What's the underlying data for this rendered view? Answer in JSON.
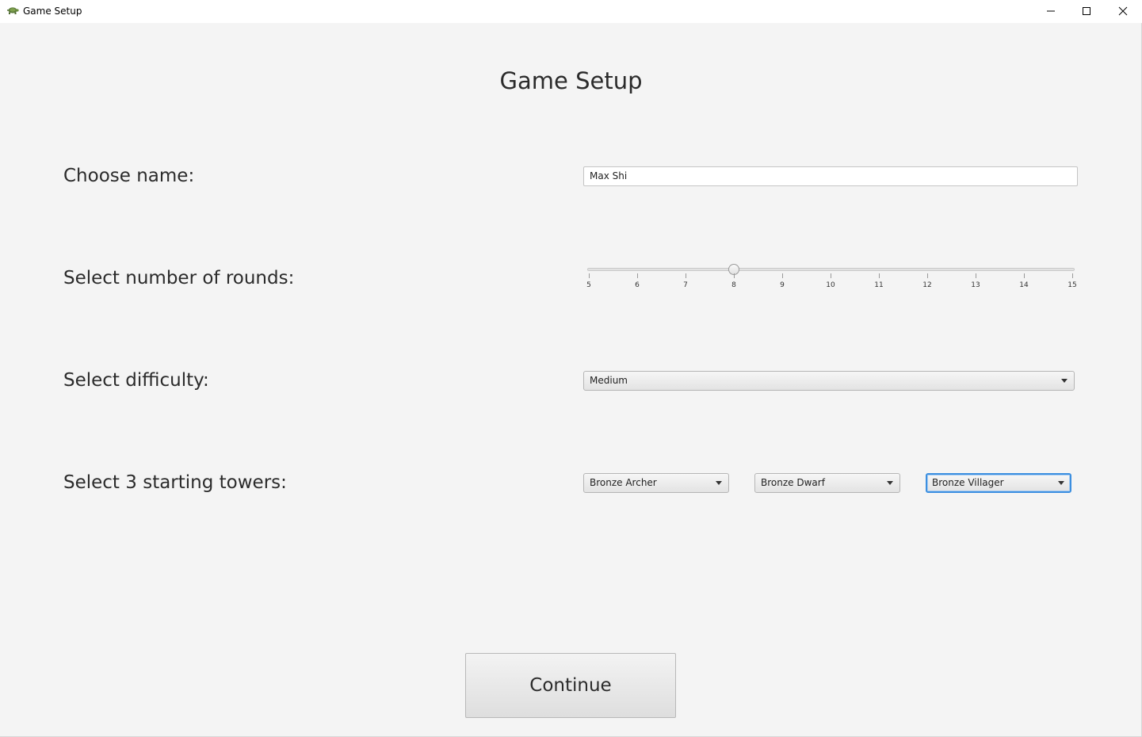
{
  "window": {
    "title": "Game Setup",
    "app_icon": "turtle-icon",
    "controls": [
      "minimize-icon",
      "maximize-icon",
      "close-icon"
    ]
  },
  "page": {
    "heading": "Game Setup"
  },
  "name_row": {
    "label": "Choose name:",
    "value": "Max Shi"
  },
  "rounds_row": {
    "label": "Select number of rounds:",
    "min": 5,
    "max": 15,
    "value": 8,
    "tick_labels": [
      "5",
      "6",
      "7",
      "8",
      "9",
      "10",
      "11",
      "12",
      "13",
      "14",
      "15"
    ]
  },
  "difficulty_row": {
    "label": "Select difficulty:",
    "selected": "Medium"
  },
  "towers_row": {
    "label": "Select 3 starting towers:",
    "towers": [
      {
        "selected": "Bronze Archer"
      },
      {
        "selected": "Bronze Dwarf"
      },
      {
        "selected": "Bronze Villager",
        "focused": true
      }
    ]
  },
  "actions": {
    "continue_label": "Continue"
  },
  "colors": {
    "background": "#f4f4f4",
    "focus_border": "#3c8fe0"
  }
}
